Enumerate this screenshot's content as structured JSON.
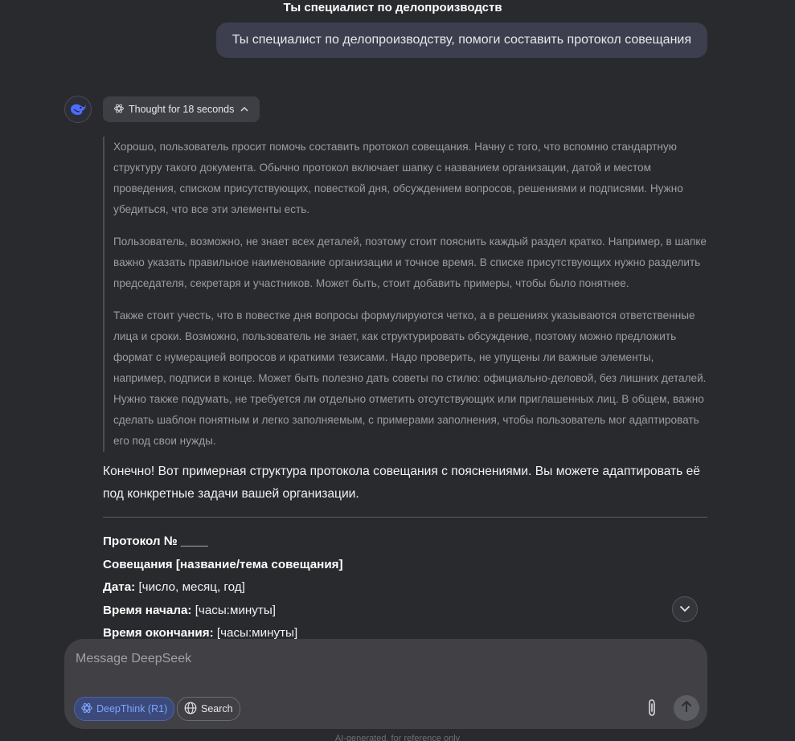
{
  "chat": {
    "title": "Ты специалист по делопроизводств"
  },
  "user_message": {
    "text": "Ты специалист по делопроизводству, помоги составить протокол совещания"
  },
  "assistant": {
    "avatar_icon": "deepseek-whale-icon",
    "thought_toggle": {
      "label": "Thought for 18 seconds",
      "icon": "atom-icon",
      "chevron": "chevron-up-icon"
    },
    "reasoning": [
      "Хорошо, пользователь просит помочь составить протокол совещания. Начну с того, что вспомню стандартную структуру такого документа. Обычно протокол включает шапку с названием организации, датой и местом проведения, списком присутствующих, повесткой дня, обсуждением вопросов, решениями и подписями. Нужно убедиться, что все эти элементы есть.",
      "Пользователь, возможно, не знает всех деталей, поэтому стоит пояснить каждый раздел кратко. Например, в шапке важно указать правильное наименование организации и точное время. В списке присутствующих нужно разделить председателя, секретаря и участников. Может быть, стоит добавить примеры, чтобы было понятнее.",
      "Также стоит учесть, что в повестке дня вопросы формулируются четко, а в решениях указываются ответственные лица и сроки. Возможно, пользователь не знает, как структурировать обсуждение, поэтому можно предложить формат с нумерацией вопросов и краткими тезисами. Надо проверить, не упущены ли важные элементы, например, подписи в конце. Может быть полезно дать советы по стилю: официально-деловой, без лишних деталей. Нужно также подумать, не требуется ли отдельно отметить отсутствующих или приглашенных лиц. В общем, важно сделать шаблон понятным и легко заполняемым, с примерами заполнения, чтобы пользователь мог адаптировать его под свои нужды."
    ],
    "answer": {
      "intro": "Конечно! Вот примерная структура протокола совещания с пояснениями. Вы можете адаптировать её под конкретные задачи вашей организации.",
      "heading_1": "Протокол № ____",
      "heading_2": "Совещания [название/тема совещания]",
      "date_label": "Дата:",
      "date_value": " [число, месяц, год]",
      "start_label": "Время начала:",
      "start_value": " [часы:минуты]",
      "end_label": "Время окончания:",
      "end_value": " [часы:минуты]"
    }
  },
  "scroll_button": {
    "icon": "chevron-down-icon"
  },
  "composer": {
    "placeholder": "Message DeepSeek",
    "deepthink_label": "DeepThink (R1)",
    "deepthink_icon": "atom-icon",
    "search_label": "Search",
    "search_icon": "globe-icon",
    "attach_icon": "paperclip-icon",
    "send_icon": "arrow-up-icon"
  },
  "footer": {
    "note": "AI-generated, for reference only"
  },
  "colors": {
    "background": "#292a2d",
    "user_bubble": "#3d3f4f",
    "composer": "#404045",
    "accent_blue": "#4d6bfe"
  }
}
